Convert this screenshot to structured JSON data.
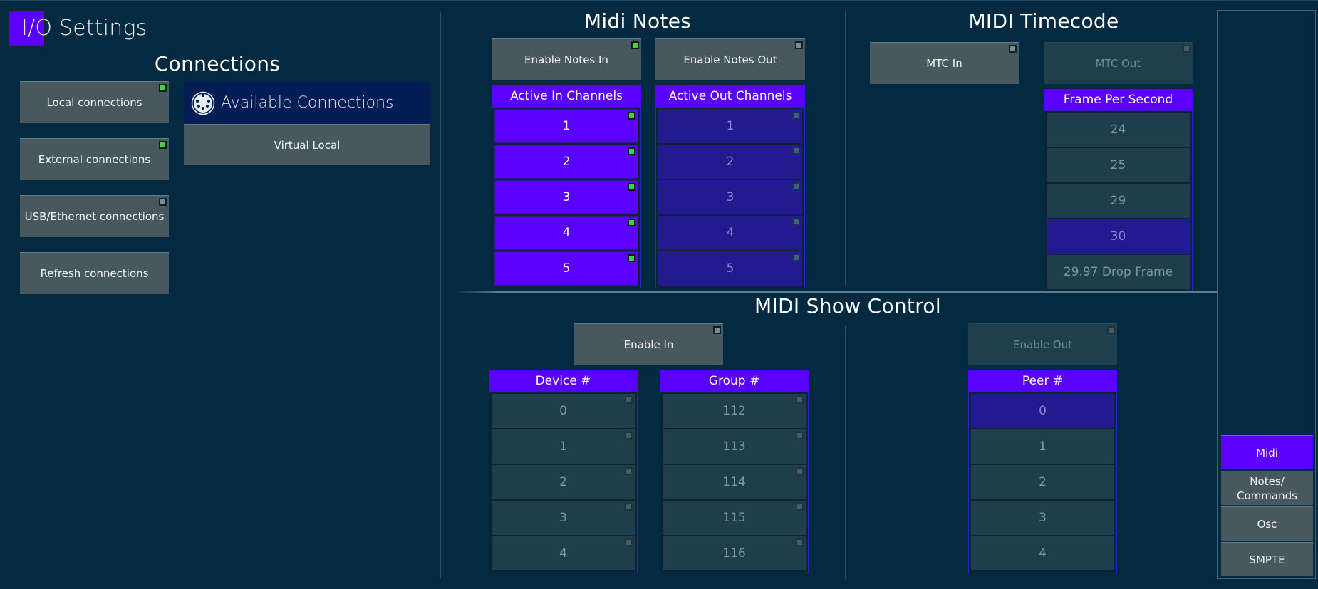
{
  "app": {
    "title": "I/O Settings"
  },
  "colors": {
    "accent": "#5a00ff",
    "background": "#032a40",
    "button": "#49585c",
    "indicator_on": "#3fd43f",
    "selected_dim": "#241a90",
    "available_header": "#041e55"
  },
  "connections": {
    "title": "Connections",
    "buttons": [
      {
        "label": "Local connections",
        "indicator": "on"
      },
      {
        "label": "External connections",
        "indicator": "on"
      },
      {
        "label": "USB/Ethernet connections",
        "indicator": "off"
      },
      {
        "label": "Refresh connections",
        "indicator": "none"
      }
    ],
    "available": {
      "icon": "midi-din-icon",
      "title": "Available Connections",
      "items": [
        "Virtual Local"
      ]
    }
  },
  "midi_notes": {
    "title": "Midi Notes",
    "enable_in": {
      "label": "Enable Notes In",
      "indicator": "on"
    },
    "enable_out": {
      "label": "Enable Notes Out",
      "indicator": "off"
    },
    "in_channels": {
      "header": "Active In Channels",
      "items": [
        {
          "label": "1",
          "active": true
        },
        {
          "label": "2",
          "active": true
        },
        {
          "label": "3",
          "active": true
        },
        {
          "label": "4",
          "active": true
        },
        {
          "label": "5",
          "active": true
        }
      ]
    },
    "out_channels": {
      "header": "Active Out Channels",
      "items": [
        {
          "label": "1",
          "active": false
        },
        {
          "label": "2",
          "active": false
        },
        {
          "label": "3",
          "active": false
        },
        {
          "label": "4",
          "active": false
        },
        {
          "label": "5",
          "active": false
        }
      ]
    }
  },
  "midi_timecode": {
    "title": "MIDI Timecode",
    "mtc_in": {
      "label": "MTC In",
      "indicator": "off"
    },
    "mtc_out": {
      "label": "MTC Out",
      "indicator": "off",
      "disabled": true
    },
    "fps": {
      "header": "Frame Per Second",
      "items": [
        "24",
        "25",
        "29",
        "30",
        "29.97 Drop Frame"
      ],
      "selected": "30"
    }
  },
  "midi_show_control": {
    "title": "MIDI Show Control",
    "enable_in": {
      "label": "Enable In",
      "indicator": "off"
    },
    "enable_out": {
      "label": "Enable Out",
      "indicator": "off",
      "disabled": true
    },
    "device": {
      "header": "Device #",
      "items": [
        "0",
        "1",
        "2",
        "3",
        "4"
      ]
    },
    "group": {
      "header": "Group #",
      "items": [
        "112",
        "113",
        "114",
        "115",
        "116"
      ]
    },
    "peer": {
      "header": "Peer #",
      "items": [
        "0",
        "1",
        "2",
        "3",
        "4"
      ],
      "selected": "0"
    }
  },
  "nav": {
    "items": [
      {
        "label": "Midi",
        "active": true
      },
      {
        "label": "Notes/\nCommands",
        "active": false
      },
      {
        "label": "Osc",
        "active": false
      },
      {
        "label": "SMPTE",
        "active": false
      }
    ]
  }
}
